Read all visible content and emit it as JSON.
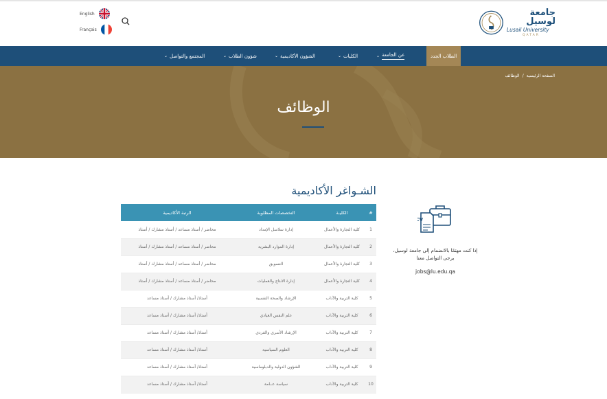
{
  "header": {
    "languages": [
      {
        "label": "English"
      },
      {
        "label": "Français"
      }
    ],
    "logo": {
      "arabic": "جامعة لوسيل",
      "english": "Lusail University",
      "sub": "QATAR"
    }
  },
  "nav": {
    "items": [
      {
        "label": "الطلاب الجدد",
        "has_chevron": false
      },
      {
        "label": "عن الجامعة",
        "has_chevron": true
      },
      {
        "label": "الكليات",
        "has_chevron": true
      },
      {
        "label": "الشؤون الأكاديمية",
        "has_chevron": true
      },
      {
        "label": "شؤون الطلاب",
        "has_chevron": true
      },
      {
        "label": "المجتمع والتواصل",
        "has_chevron": true
      }
    ]
  },
  "breadcrumb": {
    "home": "الصفحة الرئيسية",
    "separator": "/",
    "current": "الوظائف"
  },
  "hero": {
    "title": "الوظائف"
  },
  "section": {
    "title": "الشـواغر الأكاديمية"
  },
  "table": {
    "headers": [
      "#",
      "الكليـة",
      "التخصصات المطلوبة",
      "الرتبة الأكاديمية"
    ],
    "rows": [
      [
        "1",
        "كلية التجارة والأعمال",
        "إدارة سلاسل الإمداد",
        "محاضر / أستاذ مساعد / أستاذ مشارك / أستاذ"
      ],
      [
        "2",
        "كلية التجارة والأعمال",
        "إدارة الموارد البشرية",
        "محاضر / أستاذ مساعد / أستاذ مشارك / أستاذ"
      ],
      [
        "3",
        "كلية التجارة والأعمال",
        "التسويق",
        "محاضر / أستاذ مساعد / أستاذ مشارك / أستاذ"
      ],
      [
        "4",
        "كلية التجارة والأعمال",
        "إدارة الانتاج والعمليات",
        "محاضر / أستاذ مساعد / أستاذ مشارك / أستاذ"
      ],
      [
        "5",
        "كلية التربية والآداب",
        "الإرشاد والصحة النفسية",
        "أستاذ/ أستاذ مشارك / أستاذ مساعد"
      ],
      [
        "6",
        "كلية التربية والآداب",
        "علم النفس العيادي",
        "أستاذ/ أستاذ مشارك / أستاذ مساعد"
      ],
      [
        "7",
        "كلية التربية والآداب",
        "الإرشاد الأسري والفردي",
        "أستاذ/ أستاذ مشارك / أستاذ مساعد"
      ],
      [
        "8",
        "كلية التربية والآداب",
        "العلوم السياسية",
        "أستاذ/ أستاذ مشارك / أستاذ مساعد"
      ],
      [
        "9",
        "كلية التربية والآداب",
        "الشؤون الدولية والدبلوماسية",
        "أستاذ/ أستاذ مشارك / أستاذ مساعد"
      ],
      [
        "10",
        "كلية التربية والآداب",
        "سياسة عــامة",
        "أستاذ/ أستاذ مشارك / أستاذ مساعد"
      ]
    ]
  },
  "contact": {
    "line1": "إذا كنت مهتمًا بالانضمام إلى جامعة لوسيل،",
    "line2": "يرجى التواصل معنا",
    "email": "jobs@lu.edu.qa"
  },
  "colors": {
    "navy": "#1e4f79",
    "gold": "#a48756",
    "hero_bg": "#8b7142",
    "table_header": "#3a93b4"
  },
  "icons": [
    "uk-flag-icon",
    "france-flag-icon",
    "search-icon",
    "chevron-down-icon",
    "briefcase-cv-icon"
  ]
}
